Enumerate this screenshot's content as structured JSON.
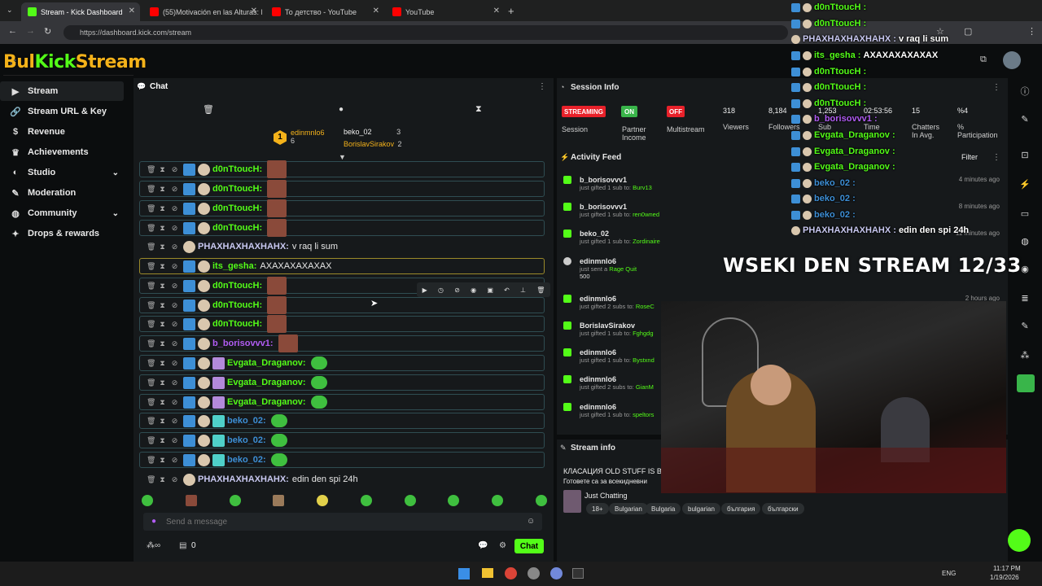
{
  "browser": {
    "tabs": [
      {
        "title": "Stream - Kick Dashboard",
        "fav": "#53fc18"
      },
      {
        "title": "(55)Motivación en las Alturas: E",
        "fav": "#ff0000"
      },
      {
        "title": "То детство - YouTube",
        "fav": "#ff0000"
      },
      {
        "title": "YouTube",
        "fav": "#ff0000"
      }
    ],
    "url": "https://dashboard.kick.com/stream"
  },
  "logo": {
    "part1": "Bul",
    "part2": "Kick",
    "part3": "Stream",
    "beta": "BETA",
    "tagline": "Livestreaming Services"
  },
  "sidebar": {
    "items": [
      {
        "label": "Stream",
        "icon": "video-icon"
      },
      {
        "label": "Stream URL & Key",
        "icon": "link-icon"
      },
      {
        "label": "Revenue",
        "icon": "dollar-icon"
      },
      {
        "label": "Achievements",
        "icon": "trophy-icon"
      },
      {
        "label": "Studio",
        "icon": "palette-icon"
      },
      {
        "label": "Moderation",
        "icon": "wrench-icon"
      },
      {
        "label": "Community",
        "icon": "globe-icon"
      },
      {
        "label": "Drops & rewards",
        "icon": "gift-icon"
      }
    ]
  },
  "chat": {
    "title": "Chat",
    "leaderboard": [
      {
        "rank": "1",
        "name": "edinmnlo6",
        "count": "6"
      },
      {
        "name": "beko_02",
        "count": "3"
      },
      {
        "name": "BorislavSirakov",
        "count": "2"
      }
    ],
    "messages": [
      {
        "user": "d0nTtoucH:",
        "color": "#53fc18",
        "text": "",
        "emote": "face"
      },
      {
        "user": "d0nTtoucH:",
        "color": "#53fc18",
        "text": "",
        "emote": "face"
      },
      {
        "user": "d0nTtoucH:",
        "color": "#53fc18",
        "text": "",
        "emote": "face"
      },
      {
        "user": "d0nTtoucH:",
        "color": "#53fc18",
        "text": "",
        "emote": "face"
      },
      {
        "user": "PHAXHAXHAXHAHX:",
        "color": "#c8c8f0",
        "text": "v raq li sum",
        "emote": ""
      },
      {
        "user": "its_gesha:",
        "color": "#53fc18",
        "text": "AXAXAXAXAXAX",
        "emote": ""
      },
      {
        "user": "d0nTtoucH:",
        "color": "#53fc18",
        "text": "",
        "emote": "face"
      },
      {
        "user": "d0nTtoucH:",
        "color": "#53fc18",
        "text": "",
        "emote": "face"
      },
      {
        "user": "d0nTtoucH:",
        "color": "#53fc18",
        "text": "",
        "emote": "face"
      },
      {
        "user": "b_borisovvv1:",
        "color": "#b15cf3",
        "text": "",
        "emote": "face"
      },
      {
        "user": "Evgata_Draganov:",
        "color": "#53fc18",
        "text": "",
        "emote": "green"
      },
      {
        "user": "Evgata_Draganov:",
        "color": "#53fc18",
        "text": "",
        "emote": "green"
      },
      {
        "user": "Evgata_Draganov:",
        "color": "#53fc18",
        "text": "",
        "emote": "green"
      },
      {
        "user": "beko_02:",
        "color": "#3d8fd6",
        "text": "",
        "emote": "green"
      },
      {
        "user": "beko_02:",
        "color": "#3d8fd6",
        "text": "",
        "emote": "green"
      },
      {
        "user": "beko_02:",
        "color": "#3d8fd6",
        "text": "",
        "emote": "green"
      },
      {
        "user": "PHAXHAXHAXHAHX:",
        "color": "#c8c8f0",
        "text": "edin den spi 24h",
        "emote": ""
      }
    ],
    "input_placeholder": "Send a message",
    "viewer_count": "0",
    "chat_button": "Chat"
  },
  "session": {
    "title": "Session Info",
    "pills": [
      {
        "label": "STREAMING",
        "color": "#e8212a",
        "caption": "Session"
      },
      {
        "label": "ON",
        "color": "#39b54a",
        "caption": "Partner Income"
      },
      {
        "label": "OFF",
        "color": "#e8212a",
        "caption": "Multistream"
      }
    ],
    "stats": [
      {
        "value": "318",
        "label": "Viewers"
      },
      {
        "value": "8,184",
        "label": "Followers"
      },
      {
        "value": "1,253",
        "label": "Sub"
      },
      {
        "value": "02:53:56",
        "label": "Time"
      },
      {
        "value": "15",
        "label": "Chatters In Avg."
      },
      {
        "value": "%4",
        "label": "% Participation"
      }
    ]
  },
  "activity": {
    "title": "Activity Feed",
    "filter": "Filter",
    "items": [
      {
        "name": "b_borisovvv1",
        "action": "just gifted 1 sub to:",
        "target": "Burv13",
        "time": "4 minutes ago"
      },
      {
        "name": "b_borisovvv1",
        "action": "just gifted 1 sub to:",
        "target": "ren0wned",
        "time": "8 minutes ago"
      },
      {
        "name": "beko_02",
        "action": "just gifted 1 sub to:",
        "target": "Zordinaire",
        "time": "11 minutes ago"
      },
      {
        "name": "edinmnlo6",
        "action": "just sent a",
        "target": "Rage Quit",
        "time": "",
        "extra": "500"
      },
      {
        "name": "edinmnlo6",
        "action": "just gifted 2 subs to:",
        "target": "RoseC",
        "time": "2 hours ago"
      },
      {
        "name": "BorislavSirakov",
        "action": "just gifted 1 sub to:",
        "target": "Fghgdg",
        "time": ""
      },
      {
        "name": "edinmnlo6",
        "action": "just gifted 1 sub to:",
        "target": "Bystxnd",
        "time": ""
      },
      {
        "name": "edinmnlo6",
        "action": "just gifted 2 subs to:",
        "target": "GianM",
        "time": ""
      },
      {
        "name": "edinmnlo6",
        "action": "just gifted 1 sub to:",
        "target": "speltors",
        "time": ""
      }
    ]
  },
  "streaminfo": {
    "title": "Stream info",
    "stream_title": "КЛАСАЦИЯ OLD STUFF IS B",
    "subtitle": "Готовете са за всекидневни",
    "category": "Just Chatting",
    "tags": [
      "18+",
      "Bulgarian",
      "Bulgaria",
      "bulgarian",
      "българия",
      "български"
    ]
  },
  "overlay": {
    "banner": "WSEKI DEN STREAM 12/33",
    "lines": [
      {
        "user": "d0nTtoucH :",
        "color": "#53fc18",
        "text": ""
      },
      {
        "user": "d0nTtoucH :",
        "color": "#53fc18",
        "text": ""
      },
      {
        "user": "PHAXHAXHAXHAHX :",
        "color": "#c8c8f0",
        "text": "v raq li sum"
      },
      {
        "user": "its_gesha :",
        "color": "#53fc18",
        "text": "AXAXAXAXAXAX"
      },
      {
        "user": "d0nTtoucH :",
        "color": "#53fc18",
        "text": ""
      },
      {
        "user": "d0nTtoucH :",
        "color": "#53fc18",
        "text": ""
      },
      {
        "user": "d0nTtoucH :",
        "color": "#53fc18",
        "text": ""
      },
      {
        "user": "b_borisovvv1 :",
        "color": "#b15cf3",
        "text": ""
      },
      {
        "user": "Evgata_Draganov :",
        "color": "#53fc18",
        "text": ""
      },
      {
        "user": "Evgata_Draganov :",
        "color": "#53fc18",
        "text": ""
      },
      {
        "user": "Evgata_Draganov :",
        "color": "#53fc18",
        "text": ""
      },
      {
        "user": "beko_02 :",
        "color": "#3d8fd6",
        "text": ""
      },
      {
        "user": "beko_02 :",
        "color": "#3d8fd6",
        "text": ""
      },
      {
        "user": "beko_02 :",
        "color": "#3d8fd6",
        "text": ""
      },
      {
        "user": "PHAXHAXHAXHAHX :",
        "color": "#c8c8f0",
        "text": "edin den spi 24h"
      }
    ]
  },
  "taskbar": {
    "lang": "ENG",
    "time": "11:17 PM",
    "date": "1/19/2026"
  }
}
